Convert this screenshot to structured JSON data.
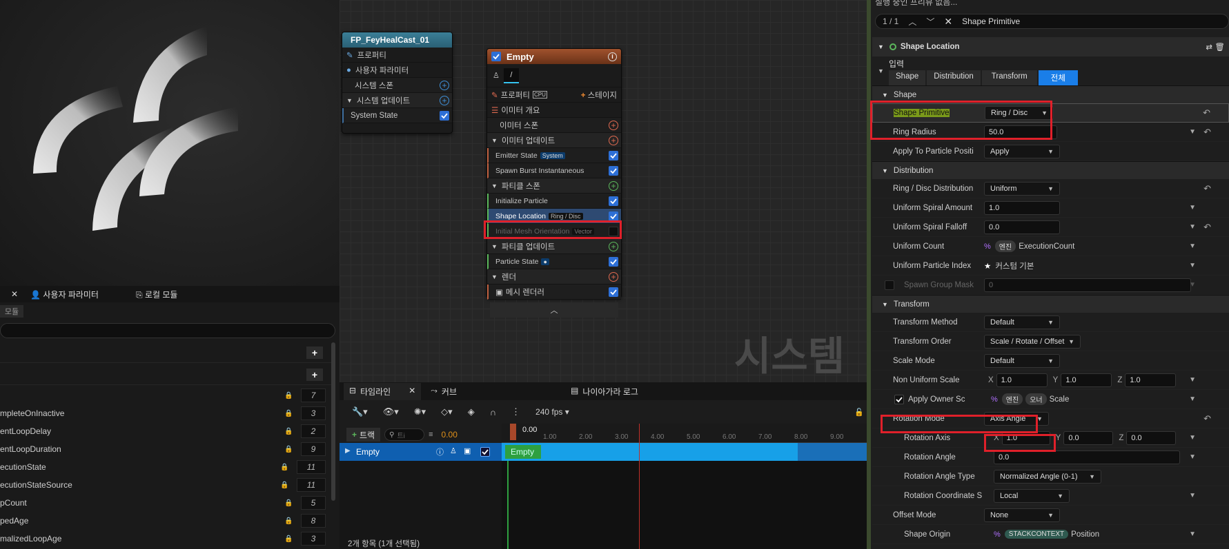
{
  "viewport": {},
  "system_node": {
    "title": "FP_FeyHealCast_01",
    "rows": [
      "프로퍼티",
      "사용자 파라미터",
      "시스템 스폰",
      "시스템 업데이트",
      "System State"
    ]
  },
  "emitter_node": {
    "title": "Empty",
    "properties": "프로퍼티",
    "cpu": "CPU",
    "stage": "스테이지",
    "emitter_summary": "이미터 개요",
    "emitter_spawn": "이미터 스폰",
    "emitter_update": "이미터 업데이트",
    "emitter_state": "Emitter State",
    "emitter_state_tag": "System",
    "spawn_burst": "Spawn Burst Instantaneous",
    "particle_spawn": "파티클 스폰",
    "initialize_particle": "Initialize Particle",
    "shape_location": "Shape Location",
    "shape_tag": "Ring / Disc",
    "mesh_orientation": "Initial Mesh Orientation",
    "mesh_tag": "Vector",
    "particle_update": "파티클 업데이트",
    "particle_state": "Particle State",
    "render": "렌더",
    "mesh_renderer": "메시 렌더러"
  },
  "watermark": "시스템",
  "params": {
    "tabs": [
      "사용자 파라미터",
      "로컬 모듈"
    ],
    "module_label": "모듈",
    "items": [
      {
        "name": "mpleteOnInactive",
        "n": "3"
      },
      {
        "name": "entLoopDelay",
        "n": "2"
      },
      {
        "name": "entLoopDuration",
        "n": "9"
      },
      {
        "name": "ecutionState",
        "n": "11"
      },
      {
        "name": "ecutionStateSource",
        "n": "11"
      },
      {
        "name": "pCount",
        "n": "5"
      },
      {
        "name": "pedAge",
        "n": "8"
      },
      {
        "name": "malizedLoopAge",
        "n": "3"
      }
    ],
    "first_n": "7"
  },
  "timeline": {
    "tabs": [
      "타임라인",
      "커브",
      "나이아가라 로그"
    ],
    "fps": "240 fps",
    "add_track": "트랙",
    "search_ph": "트i",
    "time": "0.00",
    "ruler_start": "0.00",
    "ticks": [
      "1.00",
      "2.00",
      "3.00",
      "4.00",
      "5.00",
      "6.00",
      "7.00",
      "8.00",
      "9.00"
    ],
    "track": "Empty",
    "clip": "Empty",
    "status": "2개 항목 (1개 선택됨)"
  },
  "details": {
    "top_text": "실행 중인 프리뷰 없음...",
    "search_count": "1 / 1",
    "search_text": "Shape Primitive",
    "module_title": "Shape Location",
    "input_label": "입력",
    "filter_tabs": [
      "Shape",
      "Distribution",
      "Transform",
      "전체"
    ],
    "sec_shape": "Shape",
    "shape_primitive": "Shape Primitive",
    "shape_primitive_val": "Ring / Disc",
    "ring_radius": "Ring Radius",
    "ring_radius_val": "50.0",
    "apply_pos": "Apply To Particle Positi",
    "apply_val": "Apply",
    "sec_dist": "Distribution",
    "ring_dist": "Ring / Disc Distribution",
    "ring_dist_val": "Uniform",
    "spiral_amount": "Uniform Spiral Amount",
    "spiral_amount_val": "1.0",
    "spiral_falloff": "Uniform Spiral Falloff",
    "spiral_falloff_val": "0.0",
    "uniform_count": "Uniform Count",
    "engine": "엔진",
    "exec_count": "ExecutionCount",
    "particle_index": "Uniform Particle Index",
    "custom_default": "커스텀 기본",
    "spawn_group": "Spawn Group Mask",
    "spawn_group_val": "0",
    "sec_transform": "Transform",
    "t_method": "Transform Method",
    "t_method_val": "Default",
    "t_order": "Transform Order",
    "t_order_val": "Scale / Rotate / Offset",
    "scale_mode": "Scale Mode",
    "scale_mode_val": "Default",
    "non_uniform": "Non Uniform Scale",
    "nus_x": "1.0",
    "nus_y": "1.0",
    "nus_z": "1.0",
    "apply_owner": "Apply Owner Sc",
    "owner": "오너",
    "scale": "Scale",
    "rot_mode": "Rotation Mode",
    "rot_mode_val": "Axis Angle",
    "rot_axis": "Rotation Axis",
    "ra_x": "1.0",
    "ra_y": "0.0",
    "ra_z": "0.0",
    "rot_angle": "Rotation Angle",
    "rot_angle_val": "0.0",
    "rot_angle_type": "Rotation Angle Type",
    "rot_angle_type_val": "Normalized Angle (0-1)",
    "rot_coord": "Rotation Coordinate S",
    "rot_coord_val": "Local",
    "offset_mode": "Offset Mode",
    "offset_mode_val": "None",
    "shape_origin": "Shape Origin",
    "stackcontext": "STACKCONTEXT",
    "position": "Position",
    "x": "X",
    "y": "Y",
    "z": "Z"
  }
}
